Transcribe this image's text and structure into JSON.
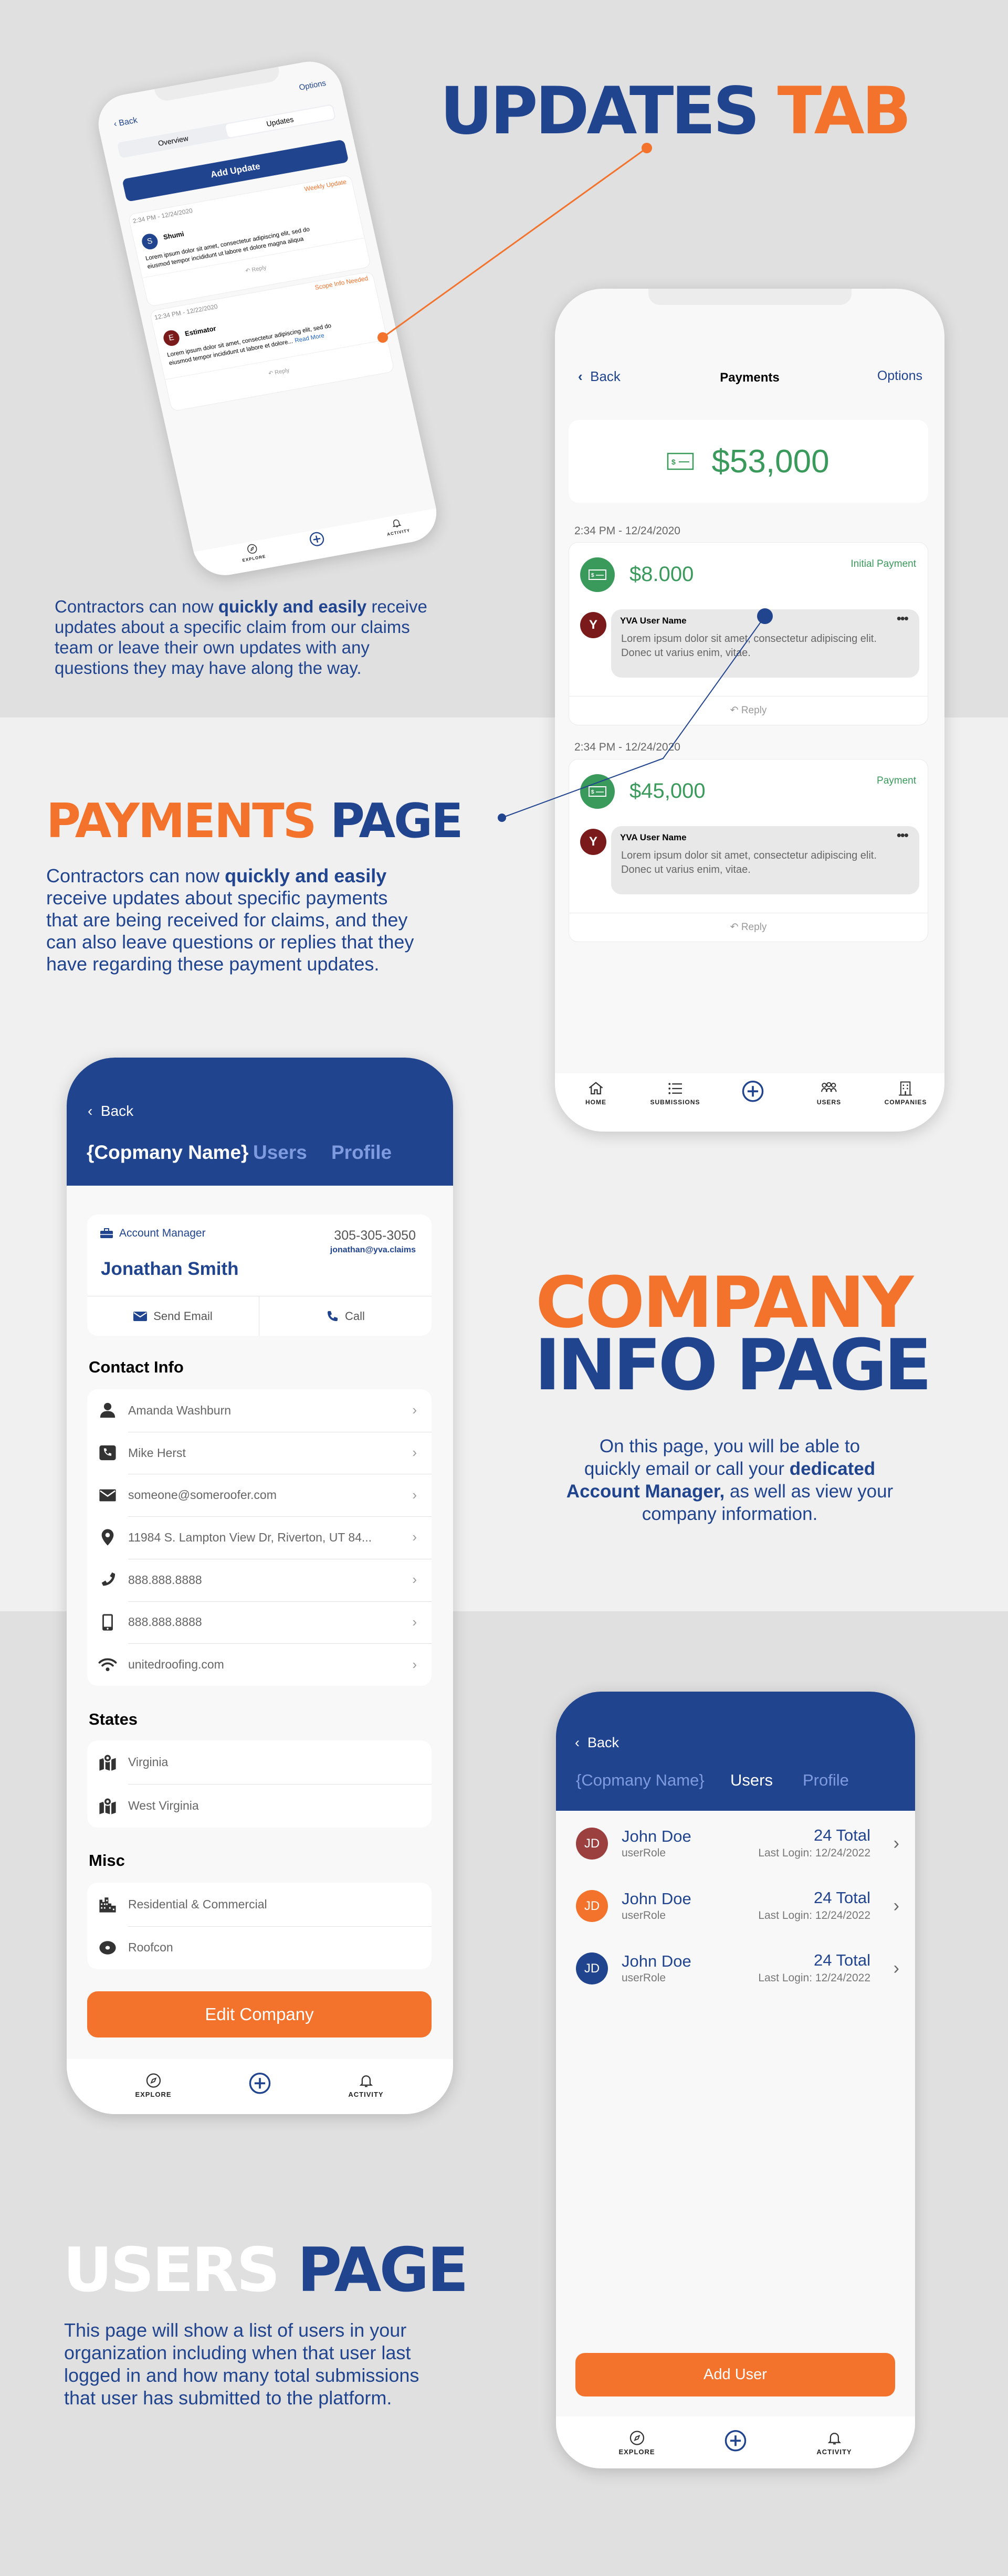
{
  "colors": {
    "orange": "#f3722c",
    "blue": "#21448f",
    "green": "#3a9a5b",
    "maroon": "#7b1a1a"
  },
  "sections": {
    "updates": {
      "heading_a": "UPDATES",
      "heading_b": "TAB",
      "paragraph": [
        [
          {
            "t": "Contractors can now "
          },
          {
            "t": "quickly and easily",
            "b": true
          },
          {
            "t": " receive"
          }
        ],
        [
          {
            "t": "updates about a specific claim from our claims"
          }
        ],
        [
          {
            "t": "team or leave their own updates with any"
          }
        ],
        [
          {
            "t": "questions they may have along the way."
          }
        ]
      ]
    },
    "payments": {
      "heading_a": "PAYMENTS",
      "heading_b": "PAGE",
      "paragraph": [
        [
          {
            "t": "Contractors can now "
          },
          {
            "t": "quickly and easily",
            "b": true
          }
        ],
        [
          {
            "t": "receive updates about specific payments"
          }
        ],
        [
          {
            "t": "that are being received for claims, and they"
          }
        ],
        [
          {
            "t": "can also leave questions or replies that they"
          }
        ],
        [
          {
            "t": "have regarding these payment updates."
          }
        ]
      ]
    },
    "company": {
      "heading_a": "COMPANY",
      "heading_b": "INFO PAGE",
      "paragraph": [
        [
          {
            "t": "On this page, you will be able to"
          }
        ],
        [
          {
            "t": "quickly email or call your "
          },
          {
            "t": "dedicated",
            "b": true
          }
        ],
        [
          {
            "t": "Account Manager,",
            "b": true
          },
          {
            "t": " as well as view your"
          }
        ],
        [
          {
            "t": "company information."
          }
        ]
      ]
    },
    "users": {
      "heading_a": "USERS",
      "heading_b": "PAGE",
      "paragraph": [
        [
          {
            "t": "This page will show a list of users in your"
          }
        ],
        [
          {
            "t": "organization including when that user last"
          }
        ],
        [
          {
            "t": "logged in and how many total submissions"
          }
        ],
        [
          {
            "t": "that user has submitted to the platform."
          }
        ]
      ]
    }
  },
  "updates_screen": {
    "back": "Back",
    "options": "Options",
    "tabs": [
      {
        "label": "Overview",
        "active": false
      },
      {
        "label": "Updates",
        "active": true
      }
    ],
    "add_button": "Add Update",
    "items": [
      {
        "time": "2:34 PM - 12/24/2020",
        "tag": "Weekly Update",
        "avatar": "S",
        "avatar_color": "#21448f",
        "author": "Shumi",
        "text1": "Lorem ipsum dolor sit amet, consectetur adipiscing elit, sed do",
        "text2": "eiusmod tempor incididunt ut labore et dolore magna aliqua",
        "read_more": "",
        "reply": "Reply"
      },
      {
        "time": "12:34 PM - 12/22/2020",
        "tag": "Scope Info Needed",
        "avatar": "E",
        "avatar_color": "#7b1a1a",
        "author": "Estimator",
        "text1": "Lorem ipsum dolor sit amet, consectetur adipiscing elit, sed do",
        "text2": "eiusmod tempor incididunt ut labore et dolore...",
        "read_more": "Read More",
        "reply": "Reply"
      }
    ],
    "nav": [
      {
        "label": "EXPLORE",
        "icon": "compass-icon"
      },
      {
        "label": "",
        "icon": "plus-circle-icon"
      },
      {
        "label": "ACTIVITY",
        "icon": "bell-icon"
      }
    ]
  },
  "payments_screen": {
    "back": "Back",
    "title": "Payments",
    "options": "Options",
    "total": "$53,000",
    "items": [
      {
        "time": "2:34 PM - 12/24/2020",
        "amount": "$8.000",
        "label": "Initial Payment",
        "avatar": "Y",
        "user": "YVA User Name",
        "text1": "Lorem ipsum dolor sit amet, consectetur adipiscing elit.",
        "text2": "Donec ut varius enim, vitae.",
        "reply": "Reply"
      },
      {
        "time": "2:34 PM - 12/24/2020",
        "amount": "$45,000",
        "label": "Payment",
        "avatar": "Y",
        "user": "YVA User Name",
        "text1": "Lorem ipsum dolor sit amet, consectetur adipiscing elit.",
        "text2": "Donec ut varius enim, vitae.",
        "reply": "Reply"
      }
    ],
    "nav": [
      {
        "label": "HOME",
        "icon": "home-icon"
      },
      {
        "label": "SUBMISSIONS",
        "icon": "list-icon"
      },
      {
        "label": "",
        "icon": "plus-circle-icon"
      },
      {
        "label": "USERS",
        "icon": "users-icon"
      },
      {
        "label": "COMPANIES",
        "icon": "building-icon"
      }
    ]
  },
  "company_screen": {
    "back": "Back",
    "tabs": [
      {
        "label": "{Copmany Name}",
        "active": true
      },
      {
        "label": "Users",
        "active": false
      },
      {
        "label": "Profile",
        "active": false
      }
    ],
    "manager": {
      "role": "Account Manager",
      "name": "Jonathan Smith",
      "phone": "305-305-3050",
      "email": "jonathan@yva.claims",
      "email_button": "Send Email",
      "call_button": "Call"
    },
    "contact_title": "Contact Info",
    "contact": [
      {
        "icon": "person-icon",
        "text": "Amanda Washburn"
      },
      {
        "icon": "phone-square-icon",
        "text": "Mike Herst"
      },
      {
        "icon": "envelope-icon",
        "text": "someone@someroofer.com"
      },
      {
        "icon": "map-pin-icon",
        "text": "11984 S. Lampton View Dr, Riverton, UT 84..."
      },
      {
        "icon": "phone-icon",
        "text": "888.888.8888"
      },
      {
        "icon": "mobile-icon",
        "text": "888.888.8888"
      },
      {
        "icon": "wifi-icon",
        "text": "unitedroofing.com"
      }
    ],
    "states_title": "States",
    "states": [
      {
        "icon": "map-icon",
        "text": "Virginia"
      },
      {
        "icon": "map-icon",
        "text": "West Virginia"
      }
    ],
    "misc_title": "Misc",
    "misc": [
      {
        "icon": "city-icon",
        "text": "Residential & Commercial"
      },
      {
        "icon": "disc-icon",
        "text": "Roofcon"
      }
    ],
    "edit_button": "Edit Company",
    "nav": [
      {
        "label": "EXPLORE",
        "icon": "compass-icon"
      },
      {
        "label": "",
        "icon": "plus-circle-icon"
      },
      {
        "label": "ACTIVITY",
        "icon": "bell-icon"
      }
    ]
  },
  "users_screen": {
    "back": "Back",
    "tabs": [
      {
        "label": "{Copmany Name}",
        "active": false
      },
      {
        "label": "Users",
        "active": true
      },
      {
        "label": "Profile",
        "active": false
      }
    ],
    "users": [
      {
        "initials": "JD",
        "color": "#9c3f3f",
        "name": "John Doe",
        "role": "userRole",
        "total": "24 Total",
        "last_login": "Last Login: 12/24/2022"
      },
      {
        "initials": "JD",
        "color": "#f3722c",
        "name": "John Doe",
        "role": "userRole",
        "total": "24 Total",
        "last_login": "Last Login: 12/24/2022"
      },
      {
        "initials": "JD",
        "color": "#21448f",
        "name": "John Doe",
        "role": "userRole",
        "total": "24 Total",
        "last_login": "Last Login: 12/24/2022"
      }
    ],
    "add_button": "Add User",
    "nav": [
      {
        "label": "EXPLORE",
        "icon": "compass-icon"
      },
      {
        "label": "",
        "icon": "plus-circle-icon"
      },
      {
        "label": "ACTIVITY",
        "icon": "bell-icon"
      }
    ]
  }
}
